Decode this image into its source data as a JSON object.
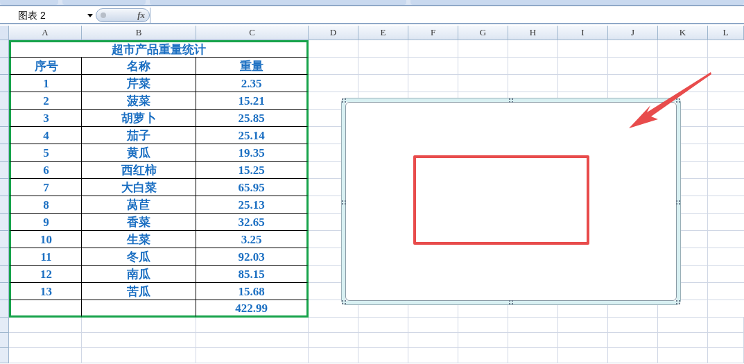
{
  "name_box": {
    "value": "图表 2"
  },
  "formula_bar": {
    "function_button": "fx"
  },
  "column_headers": [
    "A",
    "B",
    "C",
    "D",
    "E",
    "F",
    "G",
    "H",
    "I",
    "J",
    "K",
    "L"
  ],
  "table": {
    "title": "超市产品重量统计",
    "columns": [
      "序号",
      "名称",
      "重量"
    ],
    "rows": [
      [
        "1",
        "芹菜",
        "2.35"
      ],
      [
        "2",
        "菠菜",
        "15.21"
      ],
      [
        "3",
        "胡萝卜",
        "25.85"
      ],
      [
        "4",
        "茄子",
        "25.14"
      ],
      [
        "5",
        "黄瓜",
        "19.35"
      ],
      [
        "6",
        "西红柿",
        "15.25"
      ],
      [
        "7",
        "大白菜",
        "65.95"
      ],
      [
        "8",
        "莴苣",
        "25.13"
      ],
      [
        "9",
        "香菜",
        "32.65"
      ],
      [
        "10",
        "生菜",
        "3.25"
      ],
      [
        "11",
        "冬瓜",
        "92.03"
      ],
      [
        "12",
        "南瓜",
        "85.15"
      ],
      [
        "13",
        "苦瓜",
        "15.68"
      ]
    ],
    "total": "422.99"
  },
  "chart": {
    "selected": true
  }
}
